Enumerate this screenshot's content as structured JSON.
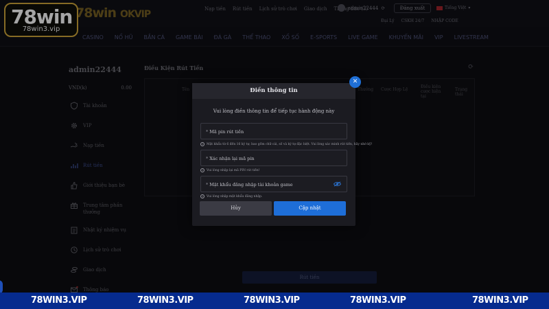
{
  "brand": {
    "name": "78win",
    "url": "78win3.vip"
  },
  "site": {
    "logo": "78win",
    "partner": "OKVIP"
  },
  "top_links": [
    "Nạp tiền",
    "Rút tiền",
    "Lịch sử trò chơi",
    "Giao dịch",
    "Thông báo (3)"
  ],
  "user": {
    "name": "admin22444",
    "logout_label": "Đăng xuất",
    "language": "Tiếng Việt"
  },
  "sub_top": [
    "Đại Lý",
    "CSKH 24/7",
    "NHẬP CODE"
  ],
  "nav": [
    "CASINO",
    "NỔ HŨ",
    "BẮN CÁ",
    "GAME BÀI",
    "ĐÁ GÀ",
    "THỂ THAO",
    "XỔ SỐ",
    "E-SPORTS",
    "LIVE GAME",
    "KHUYẾN MÃI",
    "VIP",
    "LIVESTREAM"
  ],
  "sidebar": {
    "username": "admin22444",
    "currency": "VND(k)",
    "balance": "0.00",
    "items": [
      {
        "label": "Tài khoản",
        "icon": "shield-icon"
      },
      {
        "label": "VIP",
        "icon": "gear-icon"
      },
      {
        "label": "Nạp tiền",
        "icon": "hand-money-icon"
      },
      {
        "label": "Rút tiền",
        "icon": "bar-chart-icon"
      },
      {
        "label": "Giới thiệu bạn bè",
        "icon": "thumb-up-icon"
      },
      {
        "label": "Trung tâm phần thưởng",
        "icon": "gift-icon"
      },
      {
        "label": "Nhật ký nhiệm vụ",
        "icon": "clipboard-icon"
      },
      {
        "label": "Lịch sử trò chơi",
        "icon": "history-icon"
      },
      {
        "label": "Giao dịch",
        "icon": "coins-icon"
      },
      {
        "label": "Thông báo",
        "icon": "mail-icon"
      }
    ]
  },
  "content": {
    "title": "Điều Kiện Rút Tiền",
    "columns": [
      "Tên",
      "Thưởng",
      "Cược Hợp Lệ",
      "Điều kiện cược hiện tại",
      "Trạng thái"
    ],
    "withdraw_label": "Rút tiền"
  },
  "modal": {
    "title": "Điền thông tin",
    "subtitle": "Vui lòng điền thông tin để tiếp tục hành động này",
    "close_symbol": "✕",
    "fields": [
      {
        "placeholder": "Mã pin rút tiền",
        "hint": "Mật khẩu từ 6 đến 16 ký tự, bao gồm chữ cái, số và ký tự đặc biệt. Vui lòng xác minh rút tiền, hãy nhớ kỹ!"
      },
      {
        "placeholder": "Xác nhận lại mã pin",
        "hint": "Vui lòng nhập lại mã PIN rút tiền!"
      },
      {
        "placeholder": "Mật khẩu đăng nhập tài khoản game",
        "hint": "Vui lòng nhập mật khẩu đăng nhập."
      }
    ],
    "cancel_label": "Hủy",
    "submit_label": "Cập nhật"
  },
  "watermark": [
    "78WIN3.VIP",
    "78WIN3.VIP",
    "78WIN3.VIP",
    "78WIN3.VIP",
    "78WIN3.VIP"
  ],
  "colors": {
    "accent_blue": "#1e6ed8",
    "gold": "#cfa63a",
    "band_blue": "#062b8e"
  }
}
